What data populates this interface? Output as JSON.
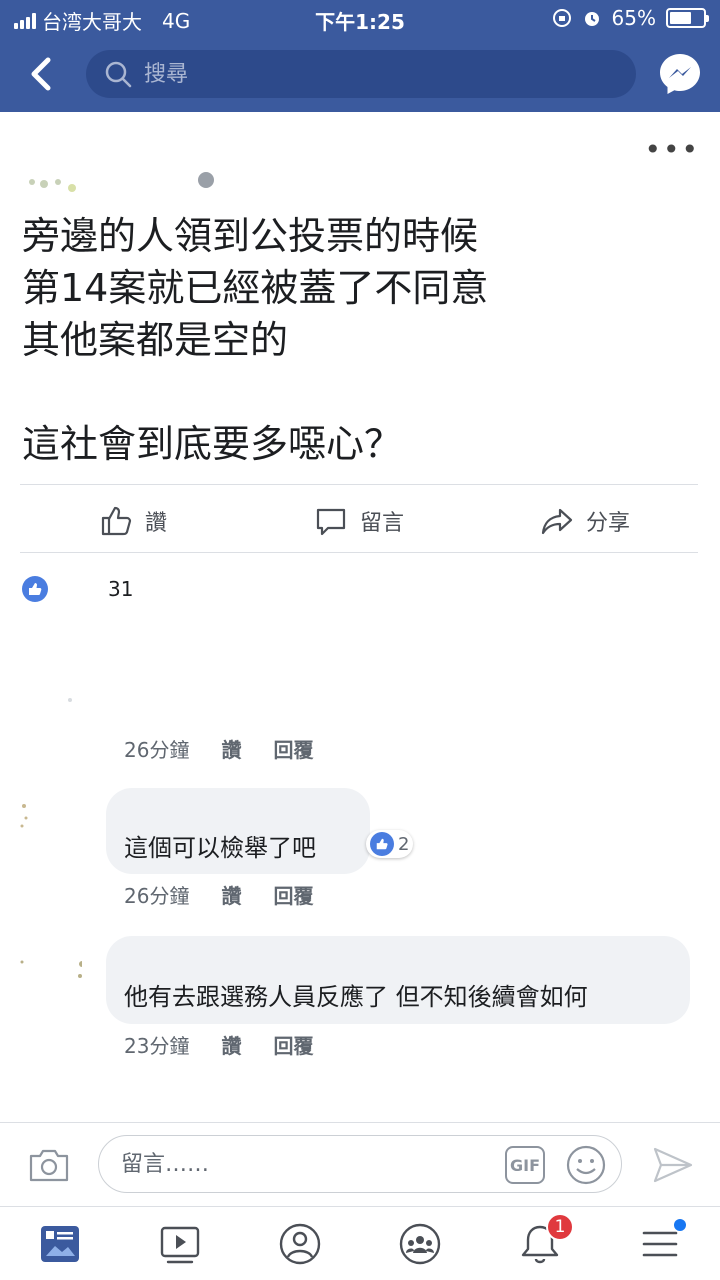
{
  "status_bar": {
    "carrier": "台湾大哥大",
    "network": "4G",
    "time": "下午1:25",
    "battery": "65%",
    "battery_level": 0.65
  },
  "header": {
    "search_placeholder": "搜尋"
  },
  "post": {
    "text": "旁邊的人領到公投票的時候\n第14案就已經被蓋了不同意\n其他案都是空的\n\n這社會到底要多噁心？",
    "actions": {
      "like": "讚",
      "comment": "留言",
      "share": "分享"
    },
    "reaction_count": "31"
  },
  "comments": [
    {
      "text": "",
      "time": "26分鐘",
      "like": "讚",
      "reply": "回覆"
    },
    {
      "text": "這個可以檢舉了吧",
      "time": "26分鐘",
      "like": "讚",
      "reply": "回覆",
      "reactions": "2"
    },
    {
      "text": "他有去跟選務人員反應了 但不知後續會如何",
      "time": "23分鐘",
      "like": "讚",
      "reply": "回覆"
    }
  ],
  "composer": {
    "placeholder": "留言……",
    "gif_label": "GIF"
  },
  "bottom_nav": {
    "notifications_badge": "1"
  },
  "colors": {
    "header_blue": "#3b5a9e",
    "like_blue": "#4a7de0",
    "badge_red": "#e0393e"
  }
}
